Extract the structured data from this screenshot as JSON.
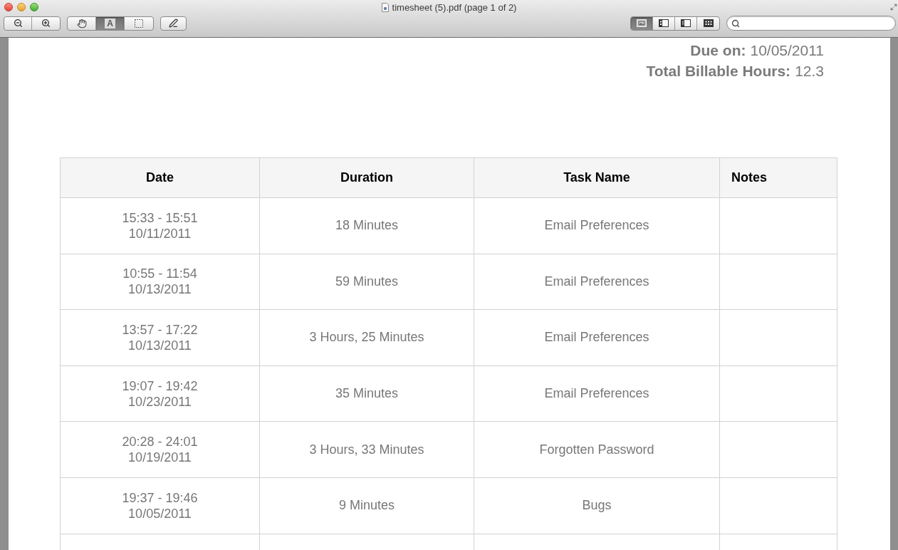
{
  "window": {
    "title": "timesheet (5).pdf (page 1 of 2)"
  },
  "toolbar": {
    "tools": [
      {
        "kind": "hand",
        "selected": false
      },
      {
        "kind": "text",
        "label": "A",
        "selected": true
      },
      {
        "kind": "marquee",
        "selected": false
      }
    ],
    "views": [
      {
        "kind": "single",
        "selected": true
      },
      {
        "kind": "sidebar",
        "selected": false
      },
      {
        "kind": "contents",
        "selected": false
      },
      {
        "kind": "grid",
        "selected": false
      }
    ]
  },
  "summary": [
    {
      "label": "Due on:",
      "value": "10/05/2011"
    },
    {
      "label": "Total Billable Hours:",
      "value": "12.3"
    }
  ],
  "table": {
    "columns": [
      "Date",
      "Duration",
      "Task Name",
      "Notes"
    ],
    "rows": [
      {
        "time": "15:33 - 15:51",
        "date": "10/11/2011",
        "duration": "18 Minutes",
        "task_name": "Email Preferences"
      },
      {
        "time": "10:55 - 11:54",
        "date": "10/13/2011",
        "duration": "59 Minutes",
        "task_name": "Email Preferences"
      },
      {
        "time": "13:57 - 17:22",
        "date": "10/13/2011",
        "duration": "3 Hours, 25 Minutes",
        "task_name": "Email Preferences"
      },
      {
        "time": "19:07 - 19:42",
        "date": "10/23/2011",
        "duration": "35 Minutes",
        "task_name": "Email Preferences"
      },
      {
        "time": "20:28 - 24:01",
        "date": "10/19/2011",
        "duration": "3 Hours, 33 Minutes",
        "task_name": "Forgotten Password"
      },
      {
        "time": "19:37 - 19:46",
        "date": "10/05/2011",
        "duration": "9 Minutes",
        "task_name": "Bugs"
      }
    ]
  }
}
